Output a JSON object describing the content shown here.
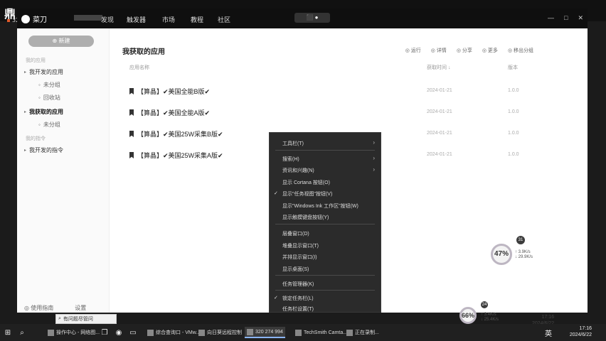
{
  "remote_viewer": {
    "logo": "鼎",
    "session_id": "320 274 994"
  },
  "app": {
    "brand": "菜刀",
    "nav": [
      "",
      "发现",
      "触发器",
      "市场",
      "教程",
      "社区"
    ],
    "record_pill": "⬛ ●",
    "win_controls": [
      "—",
      "□",
      "✕"
    ]
  },
  "sidebar": {
    "new_button": "⊕ 新建",
    "section1": "我的应用",
    "items": [
      {
        "label": "我开发的应用",
        "icon": "▸",
        "sub": false
      },
      {
        "label": "未分组",
        "icon": "◦",
        "sub": true
      },
      {
        "label": "回收站",
        "icon": "◦",
        "sub": true
      },
      {
        "label": "我获取的应用",
        "icon": "▸",
        "sub": false,
        "active": true
      },
      {
        "label": "未分组",
        "icon": "◦",
        "sub": true
      }
    ],
    "section2": "我的指令",
    "items2": [
      {
        "label": "我开发的指令",
        "icon": "▸"
      }
    ],
    "footer_left": "◎ 使用指南",
    "footer_right": "设置"
  },
  "content": {
    "title": "我获取的应用",
    "actions": [
      "◎ 运行",
      "◎ 详情",
      "◎ 分享",
      "◎ 更多",
      "◎ 移出分组"
    ],
    "headers": [
      "应用名称",
      "获取时间 ↓",
      "版本"
    ],
    "rows": [
      {
        "name": "【算晶】✔美国全能B版✔",
        "time": "2024-01-21",
        "ver": "1.0.0"
      },
      {
        "name": "【算晶】✔美国全能A版✔",
        "time": "2024-01-21",
        "ver": "1.0.0"
      },
      {
        "name": "【算晶】✔美国25W采集B版✔",
        "time": "2024-01-21",
        "ver": "1.0.0"
      },
      {
        "name": "【算晶】✔美国25W采集A版✔",
        "time": "2024-01-21",
        "ver": "1.0.0"
      }
    ]
  },
  "context_menu": {
    "items": [
      {
        "label": "工具栏(T)",
        "arrow": true
      },
      {
        "label": "搜索(H)",
        "arrow": true
      },
      {
        "label": "资讯和兴趣(N)",
        "arrow": true
      },
      {
        "label": "显示 Cortana 按钮(O)"
      },
      {
        "label": "显示\"任务视图\"按钮(V)",
        "checked": true
      },
      {
        "label": "显示\"Windows Ink 工作区\"按钮(W)"
      },
      {
        "label": "显示触摸键盘按钮(Y)"
      },
      {
        "label": "层叠窗口(D)"
      },
      {
        "label": "堆叠显示窗口(T)"
      },
      {
        "label": "并排显示窗口(I)"
      },
      {
        "label": "显示桌面(S)"
      },
      {
        "label": "任务管理器(K)"
      },
      {
        "label": "锁定任务栏(L)",
        "checked": true
      },
      {
        "label": "任务栏设置(T)"
      }
    ]
  },
  "widgets": {
    "gauge1": {
      "value": "47%",
      "badge": "31",
      "net": [
        "↑ 3.9K/s",
        "↓ 29.9K/s"
      ]
    },
    "gauge2": {
      "value": "66%",
      "badge": "24",
      "net": [
        "↑ 3.4K/s",
        "↓ 25.4K/s"
      ]
    }
  },
  "taskbar": {
    "search": "有问题尽管问",
    "apps": [
      {
        "label": "操作中心 - 网络图...",
        "active": false
      },
      {
        "label": "综合查询口 - VMw...",
        "active": false
      },
      {
        "label": "向日葵远程控制",
        "active": false
      },
      {
        "label": "320 274 994",
        "active": true
      },
      {
        "label": "TechSmith Camta...",
        "active": false
      },
      {
        "label": "正在录制...",
        "active": false
      }
    ],
    "lang": "英",
    "time": "17:16",
    "date": "2024/6/22",
    "inner_time": "17:16",
    "inner_date": "2024/6/22"
  }
}
